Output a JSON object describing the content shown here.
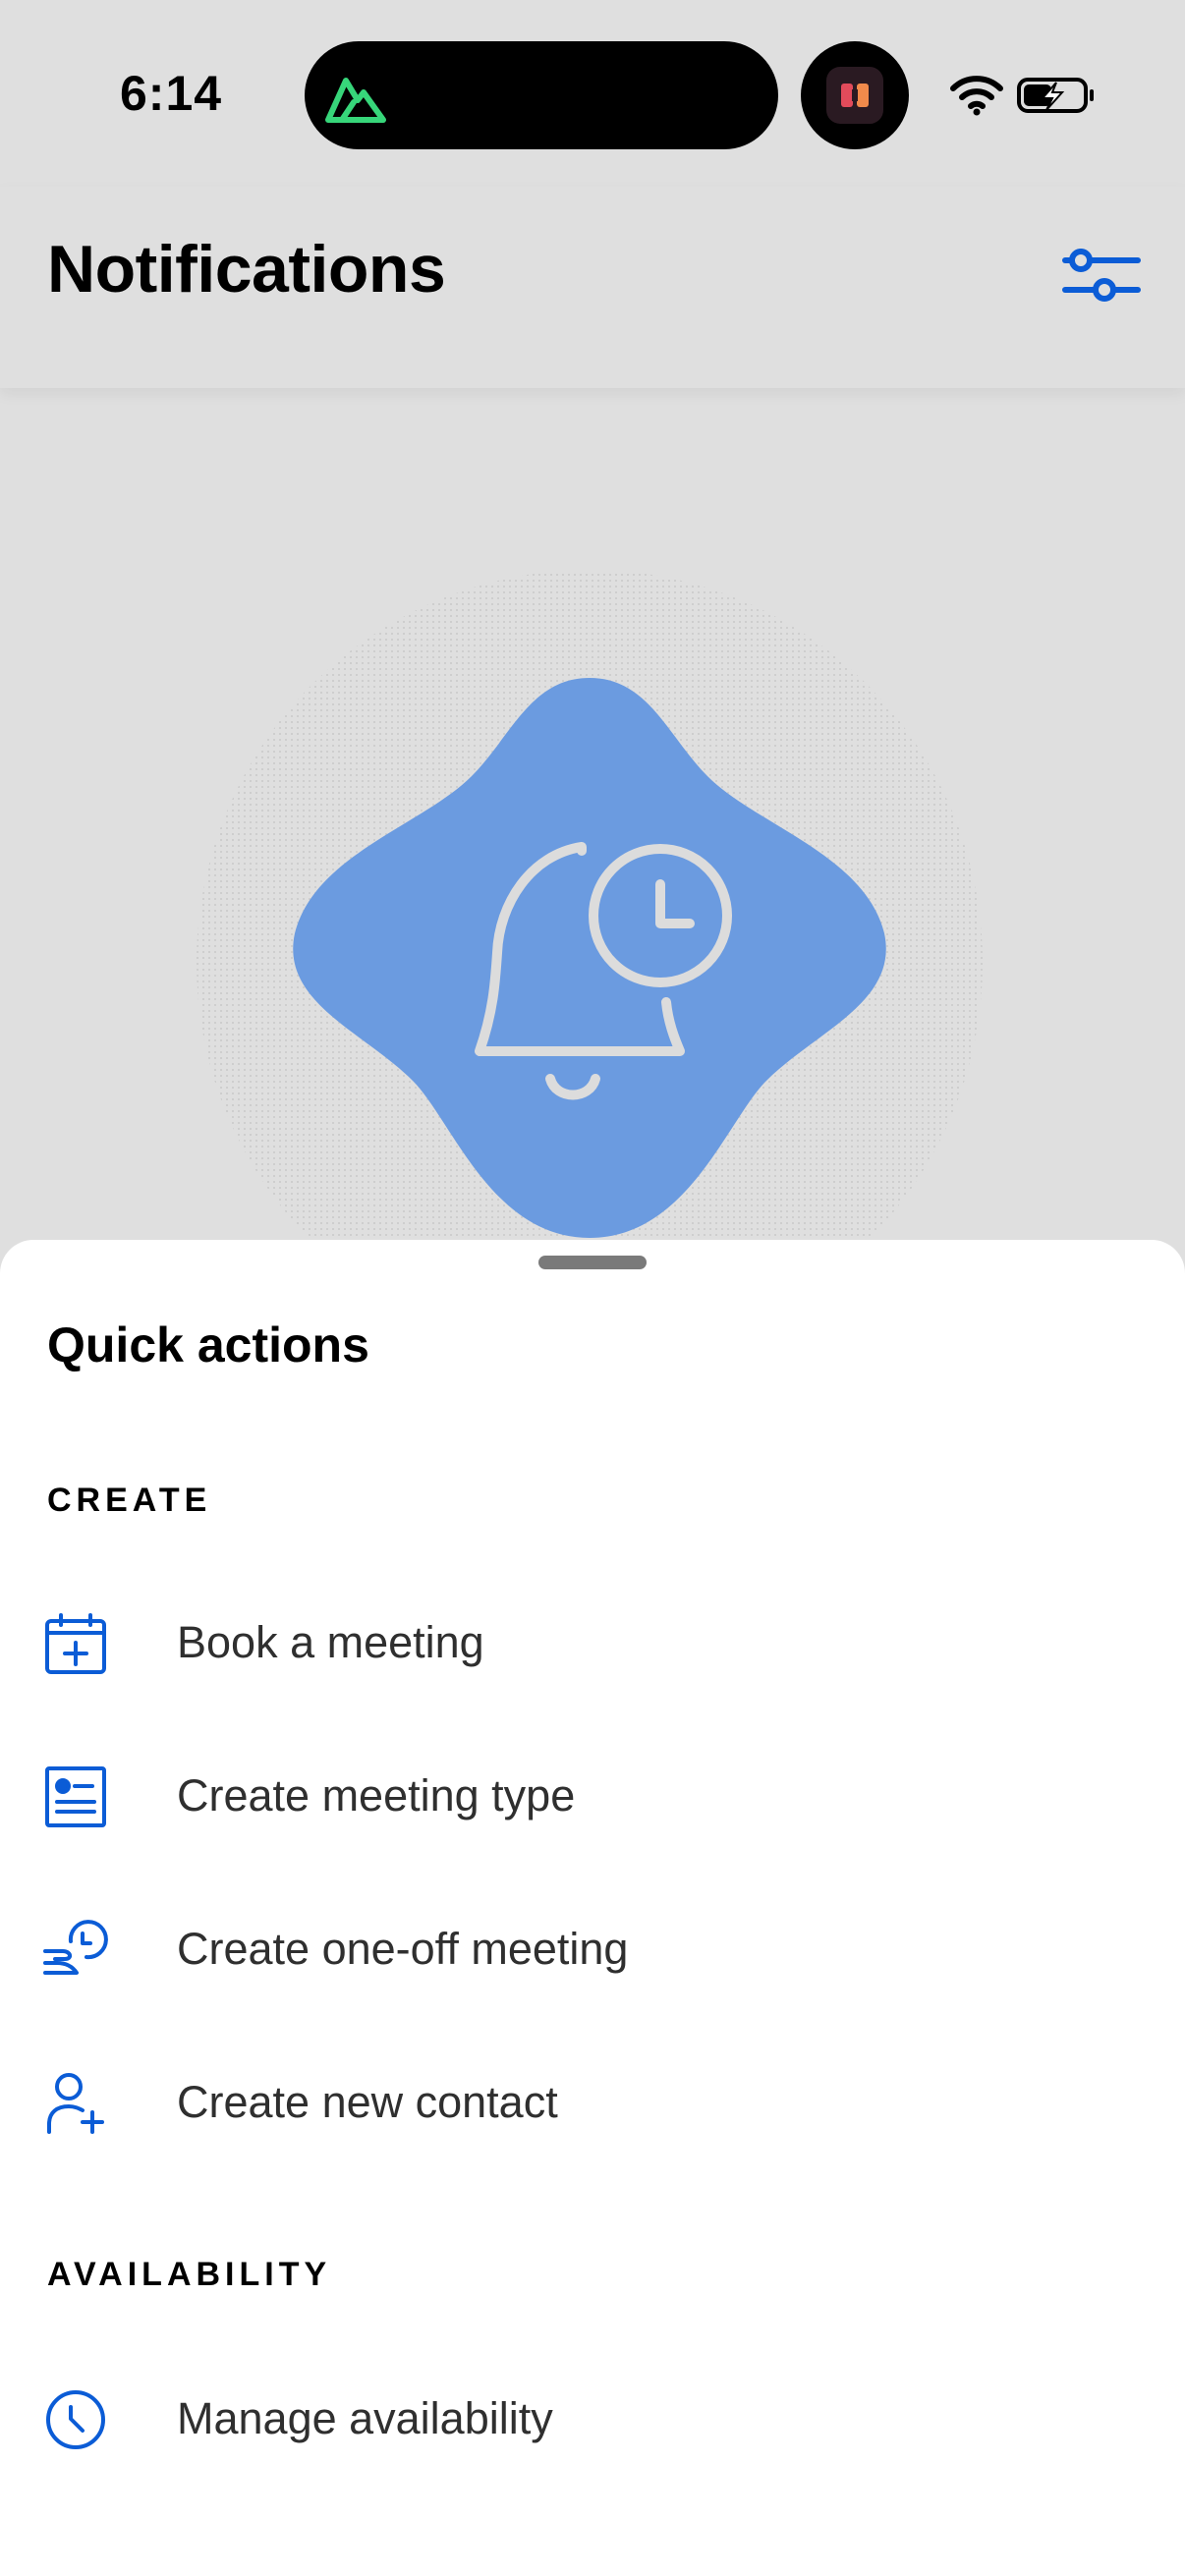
{
  "status_bar": {
    "time": "6:14"
  },
  "header": {
    "title": "Notifications",
    "filter_icon": "sliders-icon"
  },
  "illustration": {
    "icon": "bell-clock-icon",
    "accent": "#6b9be0"
  },
  "sheet": {
    "title": "Quick actions",
    "sections": [
      {
        "label": "CREATE",
        "items": [
          {
            "label": "Book a meeting",
            "icon": "calendar-plus-icon"
          },
          {
            "label": "Create meeting type",
            "icon": "document-list-icon"
          },
          {
            "label": "Create one-off meeting",
            "icon": "clock-hand-icon"
          },
          {
            "label": "Create new contact",
            "icon": "user-plus-icon"
          }
        ]
      },
      {
        "label": "AVAILABILITY",
        "items": [
          {
            "label": "Manage availability",
            "icon": "clock-icon"
          }
        ]
      }
    ]
  },
  "colors": {
    "accent": "#0b5cd6",
    "background": "#dfdfdf",
    "sheet": "#ffffff"
  }
}
